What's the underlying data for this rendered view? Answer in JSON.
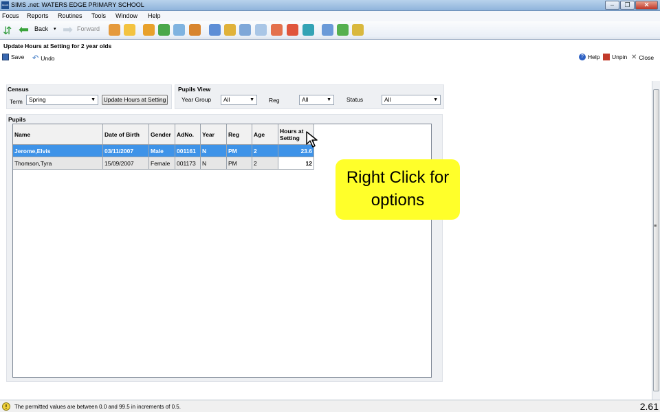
{
  "window": {
    "title": "SIMS .net: WATERS EDGE PRIMARY SCHOOL",
    "app_icon": "sims-icon"
  },
  "menu": [
    "Focus",
    "Reports",
    "Routines",
    "Tools",
    "Window",
    "Help"
  ],
  "toolbar": {
    "back_label": "Back",
    "forward_label": "Forward"
  },
  "page": {
    "title": "Update Hours at Setting for 2 year olds"
  },
  "actions": {
    "save_label": "Save",
    "undo_label": "Undo",
    "help_label": "Help",
    "unpin_label": "Unpin",
    "close_label": "Close"
  },
  "census": {
    "title": "Census",
    "term_label": "Term",
    "term_value": "Spring",
    "update_button": "Update Hours at Setting"
  },
  "pupils_view": {
    "title": "Pupils View",
    "year_group_label": "Year Group",
    "year_group_value": "All",
    "reg_label": "Reg",
    "reg_value": "All",
    "status_label": "Status",
    "status_value": "All"
  },
  "pupils": {
    "title": "Pupils",
    "columns": [
      "Name",
      "Date of Birth",
      "Gender",
      "AdNo.",
      "Year",
      "Reg",
      "Age",
      "Hours at Setting"
    ],
    "rows": [
      {
        "name": "Jerome,Elvis",
        "dob": "03/11/2007",
        "gender": "Male",
        "adno": "001161",
        "year": "N",
        "reg": "PM",
        "age": "2",
        "hours": "23.6"
      },
      {
        "name": "Thomson,Tyra",
        "dob": "15/09/2007",
        "gender": "Female",
        "adno": "001173",
        "year": "N",
        "reg": "PM",
        "age": "2",
        "hours": "12"
      }
    ]
  },
  "status": {
    "message": "The permitted values are between 0.0 and 99.5 in increments of 0.5.",
    "page_number": "2.61"
  },
  "callout": {
    "text": "Right Click for options"
  }
}
